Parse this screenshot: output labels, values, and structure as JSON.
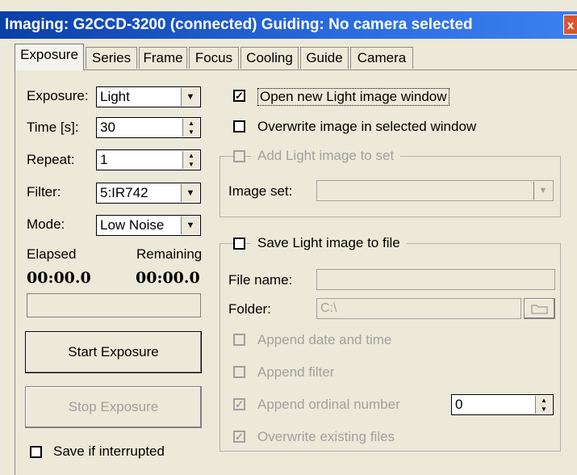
{
  "window": {
    "title": "Imaging: G2CCD-3200 (connected) Guiding: No camera selected",
    "close_glyph": "x"
  },
  "tabs": [
    "Exposure",
    "Series",
    "Frame",
    "Focus",
    "Cooling",
    "Guide",
    "Camera"
  ],
  "active_tab": "Exposure",
  "left": {
    "exposure_label": "Exposure:",
    "exposure_value": "Light",
    "time_label": "Time [s]:",
    "time_value": "30",
    "repeat_label": "Repeat:",
    "repeat_value": "1",
    "filter_label": "Filter:",
    "filter_value": "5:IR742",
    "mode_label": "Mode:",
    "mode_value": "Low Noise",
    "elapsed_label": "Elapsed",
    "remaining_label": "Remaining",
    "elapsed_value": "00:00.0",
    "remaining_value": "00:00.0",
    "start_button": "Start Exposure",
    "stop_button": "Stop Exposure",
    "save_if_interrupted": "Save if interrupted"
  },
  "right": {
    "open_new_window": "Open new Light image window",
    "overwrite_selected": "Overwrite image in selected window",
    "add_to_set": "Add Light image to set",
    "image_set_label": "Image set:",
    "image_set_value": "",
    "save_to_file": "Save Light image to file",
    "file_name_label": "File name:",
    "file_name_value": "",
    "folder_label": "Folder:",
    "folder_value": "C:\\",
    "append_date": "Append date and time",
    "append_filter": "Append filter",
    "append_ordinal": "Append ordinal number",
    "ordinal_value": "0",
    "overwrite_existing": "Overwrite existing files"
  },
  "checkbox_states": {
    "open_new_window": true,
    "overwrite_selected": false,
    "add_to_set": false,
    "save_to_file": false,
    "append_date": false,
    "append_filter": false,
    "append_ordinal": true,
    "overwrite_existing": true,
    "save_if_interrupted": false
  },
  "colors": {
    "titlebar": "#0a3fa8",
    "face": "#ece9d8",
    "disabled_text": "#a0a0a0"
  }
}
